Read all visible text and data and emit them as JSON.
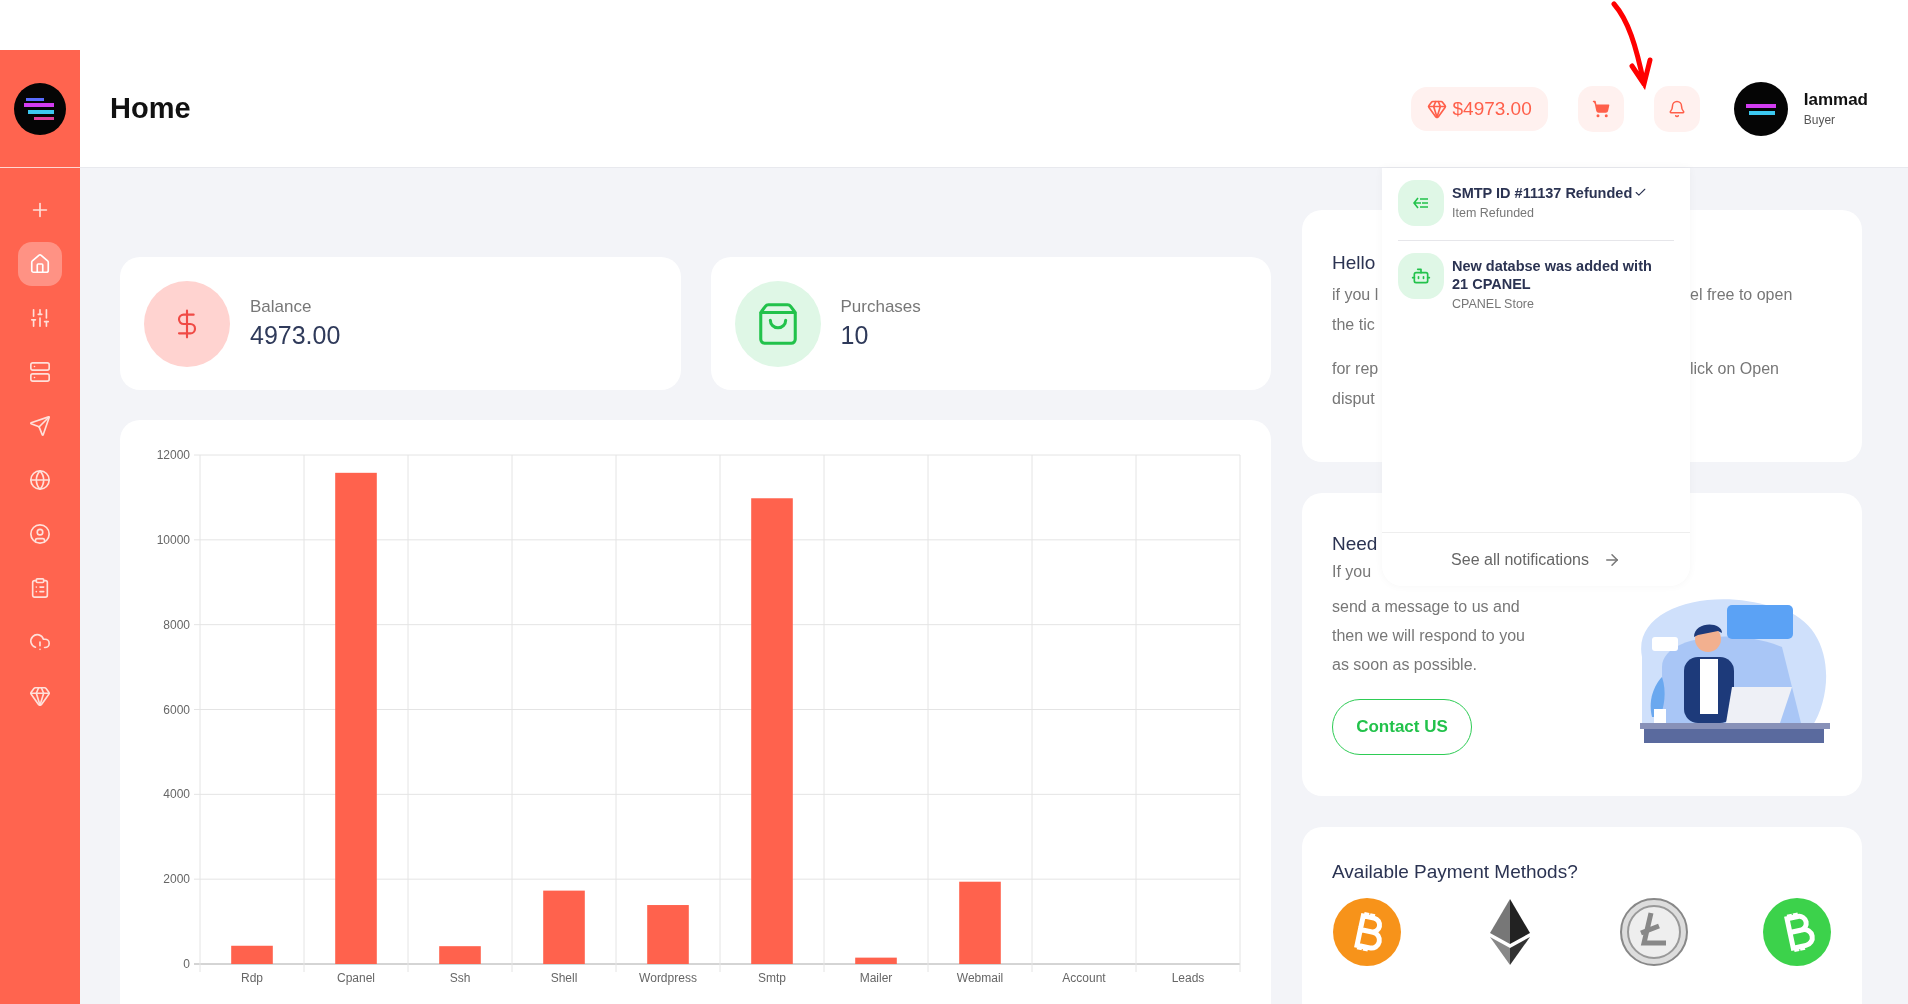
{
  "sidebar": {
    "items": [
      {
        "selected": false
      },
      {
        "selected": true
      },
      {
        "selected": false
      },
      {
        "selected": false
      },
      {
        "selected": false
      },
      {
        "selected": false
      },
      {
        "selected": false
      },
      {
        "selected": false
      },
      {
        "selected": false
      },
      {
        "selected": false
      }
    ]
  },
  "header": {
    "title": "Home",
    "balance": "$4973.00",
    "user": {
      "name": "Iammad",
      "role": "Buyer"
    }
  },
  "notifications": {
    "items": [
      {
        "kind": "refund",
        "title": "SMTP ID #11137 Refunded",
        "read": true,
        "subtitle": "Item Refunded"
      },
      {
        "kind": "robot",
        "title": "New databse was added with 21 CPANEL",
        "read": false,
        "subtitle": "CPANEL Store"
      }
    ],
    "footer": "See all notifications"
  },
  "stats": [
    {
      "kind": "balance",
      "label": "Balance",
      "value": "4973.00"
    },
    {
      "kind": "purchases",
      "label": "Purchases",
      "value": "10"
    }
  ],
  "chart_data": {
    "type": "bar",
    "categories": [
      "Rdp",
      "Cpanel",
      "Ssh",
      "Shell",
      "Wordpress",
      "Smtp",
      "Mailer",
      "Webmail",
      "Account",
      "Leads"
    ],
    "grid": true,
    "series": [
      {
        "color": "#ff624d",
        "values": [
          430,
          11580,
          420,
          1730,
          1390,
          10980,
          150,
          1940,
          0,
          0
        ]
      }
    ],
    "ylim": [
      0,
      12000
    ],
    "yticks": [
      0,
      2000,
      4000,
      6000,
      8000,
      10000,
      12000
    ]
  },
  "hello_card": {
    "title": "Hello",
    "paragraphs": [
      [
        {
          "left": "if you l",
          "right": "el free to open"
        },
        {
          "left": "the tic"
        }
      ],
      [
        {
          "left": "for rep",
          "right": "lick on Open"
        },
        {
          "left": "disput"
        }
      ]
    ]
  },
  "help_card": {
    "title": "Need",
    "lines": [
      "If you",
      "send a message to us and",
      "then we will respond to you",
      "as soon as possible."
    ],
    "button": "Contact US"
  },
  "payment": {
    "title": "Available Payment Methods?",
    "methods": [
      {
        "kind": "bitcoin"
      },
      {
        "kind": "ethereum"
      },
      {
        "kind": "litecoin"
      },
      {
        "kind": "bitcoin_cash"
      }
    ]
  }
}
